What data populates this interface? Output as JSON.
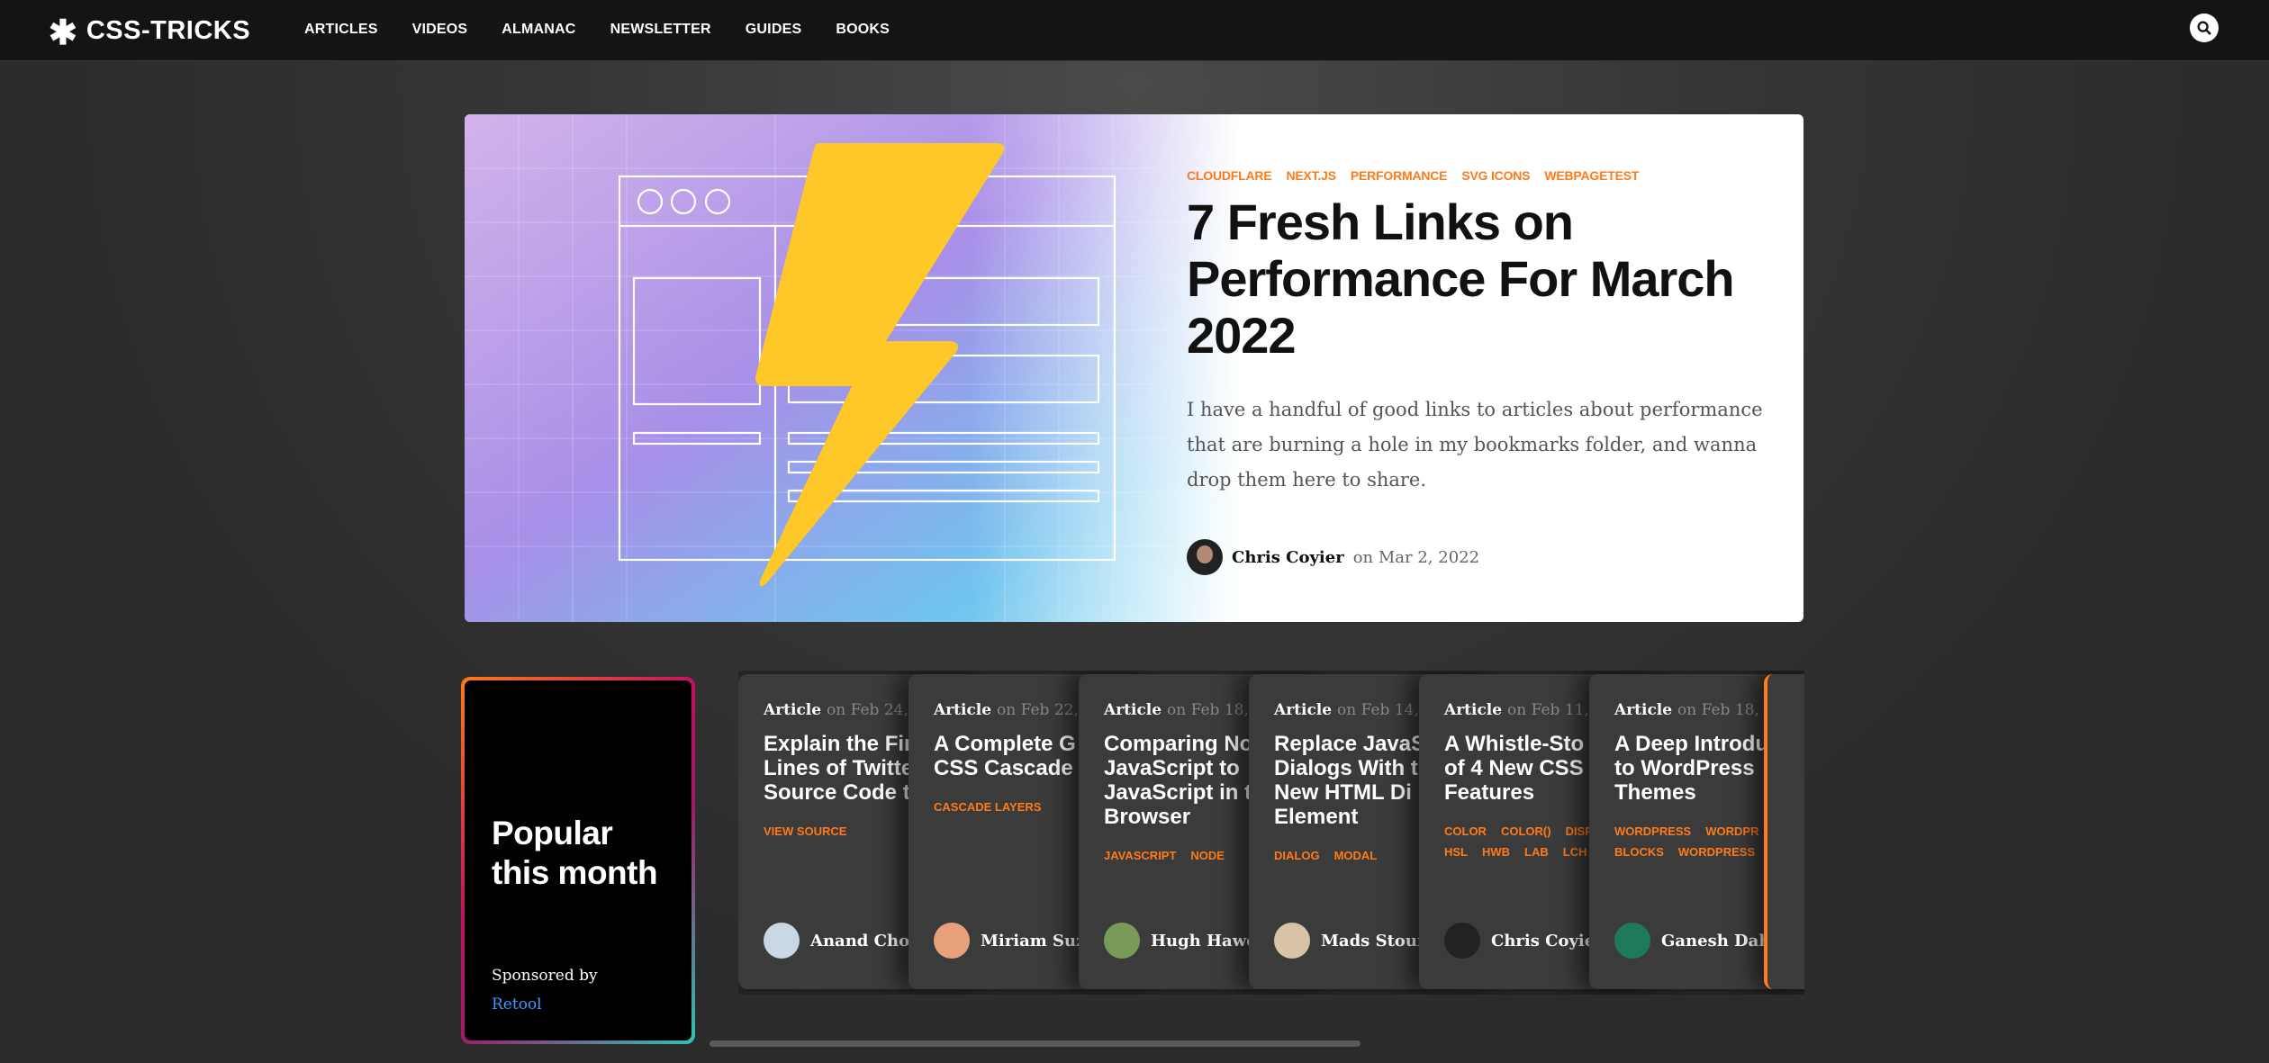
{
  "site": {
    "logo_symbol": "✱",
    "logo_text": "CSS-TRICKS"
  },
  "nav": [
    {
      "label": "ARTICLES"
    },
    {
      "label": "VIDEOS"
    },
    {
      "label": "ALMANAC"
    },
    {
      "label": "NEWSLETTER"
    },
    {
      "label": "GUIDES"
    },
    {
      "label": "BOOKS"
    }
  ],
  "search": {
    "icon": "search-icon"
  },
  "hero": {
    "tags": [
      "CLOUDFLARE",
      "NEXT.JS",
      "PERFORMANCE",
      "SVG ICONS",
      "WEBPAGETEST"
    ],
    "title": "7 Fresh Links on Performance For March 2022",
    "excerpt": "I have a handful of good links to articles about performance that are burning a hole in my bookmarks folder, and wanna drop them here to share.",
    "author": "Chris Coyier",
    "date_text": "on Mar 2, 2022"
  },
  "popular": {
    "title": "Popular this month",
    "sponsor_label": "Sponsored by",
    "sponsor_name": "Retool"
  },
  "cards": [
    {
      "kind": "Article",
      "date": "on Feb 24, 2",
      "title": "Explain the Fir\nLines of Twitte\nSource Code t",
      "tags": [
        "VIEW SOURCE"
      ],
      "author": "Anand Chow",
      "avatar_color": "#c9d6e3"
    },
    {
      "kind": "Article",
      "date": "on Feb 22, 2",
      "title": "A Complete G\nCSS Cascade",
      "tags": [
        "CASCADE LAYERS"
      ],
      "author": "Miriam Suza",
      "avatar_color": "#e8a07a"
    },
    {
      "kind": "Article",
      "date": "on Feb 18, 2",
      "title": "Comparing No\nJavaScript to\nJavaScript in t\nBrowser",
      "tags": [
        "JAVASCRIPT",
        "NODE"
      ],
      "author": "Hugh Hawor",
      "avatar_color": "#7a9a5a"
    },
    {
      "kind": "Article",
      "date": "on Feb 14, 2",
      "title": "Replace JavaS\nDialogs With t\nNew HTML Di\nElement",
      "tags": [
        "DIALOG",
        "MODAL"
      ],
      "author": "Mads Stoum",
      "avatar_color": "#d8c2a8"
    },
    {
      "kind": "Article",
      "date": "on Feb 11, 2",
      "title": "A Whistle-Sto\nof 4 New CSS\nFeatures",
      "tags": [
        "COLOR",
        "COLOR()",
        "DISP",
        "HSL",
        "HWB",
        "LAB",
        "LCH"
      ],
      "author": "Chris Coyier",
      "avatar_color": "#222222"
    },
    {
      "kind": "Article",
      "date": "on Feb 18, 2",
      "title": "A Deep Introdu\nto WordPress\nThemes",
      "tags": [
        "WORDPRESS",
        "WORDPR",
        "BLOCKS",
        "WORDPRESS"
      ],
      "author": "Ganesh Daha",
      "avatar_color": "#1f7a5c"
    }
  ],
  "colors": {
    "accent": "#ff7a18",
    "link": "#3b9cff",
    "card_bg": "#3b3b3b"
  }
}
